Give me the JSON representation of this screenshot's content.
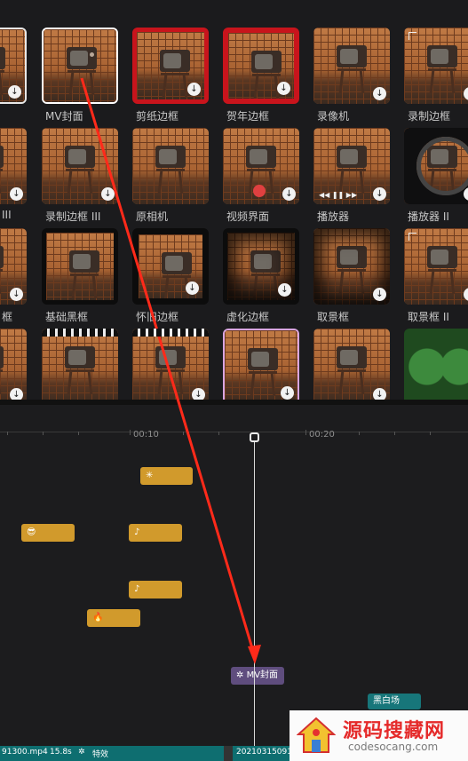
{
  "gallery": {
    "row1": [
      "MV封面",
      "剪纸边框",
      "贺年边框",
      "录像机",
      "录制边框"
    ],
    "row2": [
      "III",
      "录制边框 III",
      "原相机",
      "视频界面",
      "播放器",
      "播放器 II"
    ],
    "row3": [
      "框",
      "基础黑框",
      "怀旧边框",
      "虚化边框",
      "取景框",
      "取景框 II"
    ],
    "download_icon": "download-icon"
  },
  "timeline": {
    "ruler": [
      "00:10",
      "00:20"
    ],
    "clips": {
      "mv_cover": "MV封面",
      "black_white": "黑白场"
    }
  },
  "bottombar": {
    "file1": "91300.mp4",
    "duration": "15.8s",
    "effect_label": "特效",
    "file2": "2021031509130"
  },
  "watermark": {
    "title": "源码搜藏网",
    "url": "codesocang.com"
  },
  "annotation_color": "#ff2a1a"
}
